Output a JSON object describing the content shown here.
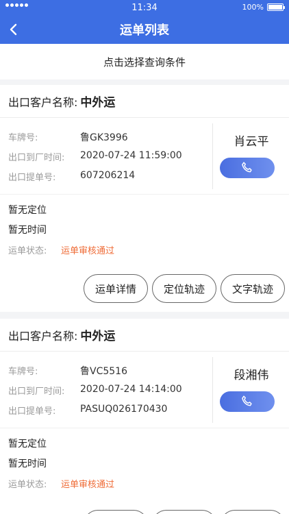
{
  "status_bar": {
    "time": "11:34",
    "battery": "100%"
  },
  "header": {
    "title": "运单列表"
  },
  "filter": {
    "label": "点击选择查询条件"
  },
  "cards": [
    {
      "customer_label": "出口客户名称:",
      "customer": "中外运",
      "plate_label": "车牌号:",
      "plate": "鲁GK3996",
      "arrive_label": "出口到厂时间:",
      "arrive_time": "2020-07-24 11:59:00",
      "bill_label": "出口提单号:",
      "bill_no": "607206214",
      "driver": "肖云平",
      "location": "暂无定位",
      "time_status": "暂无时间",
      "state_label": "运单状态:",
      "state": "运单审核通过",
      "btn_detail": "运单详情",
      "btn_track": "定位轨迹",
      "btn_text_track": "文字轨迹"
    },
    {
      "customer_label": "出口客户名称:",
      "customer": "中外运",
      "plate_label": "车牌号:",
      "plate": "鲁VC5516",
      "arrive_label": "出口到厂时间:",
      "arrive_time": "2020-07-24 14:14:00",
      "bill_label": "出口提单号:",
      "bill_no": "PASUQ026170430",
      "driver": "段湘伟",
      "location": "暂无定位",
      "time_status": "暂无时间",
      "state_label": "运单状态:",
      "state": "运单审核通过"
    }
  ],
  "colors": {
    "primary": "#3d6ee3",
    "state": "#ef6b36"
  },
  "icons": {
    "back": "chevron-left-icon",
    "call": "phone-icon"
  }
}
